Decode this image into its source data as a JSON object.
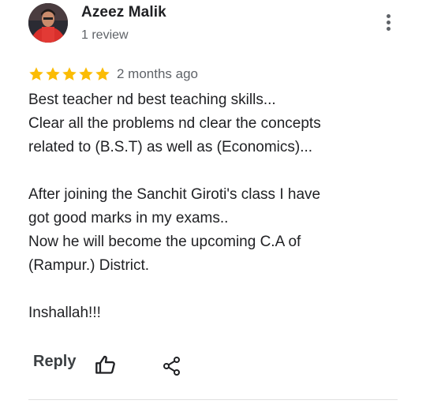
{
  "review": {
    "author": "Azeez Malik",
    "review_count": "1 review",
    "rating": 5,
    "rating_max": 5,
    "star_color": "#fbbc04",
    "date": "2 months ago",
    "lines": [
      "Best teacher nd best teaching skills...",
      "Clear all the problems nd clear the concepts",
      "related to (B.S.T) as well as (Economics)...",
      "",
      "After joining the Sanchit Giroti's class I have",
      "got good marks in my exams..",
      "Now he will become the upcoming C.A of",
      "(Rampur.) District.",
      "",
      "Inshallah!!!"
    ]
  },
  "actions": {
    "reply_label": "Reply"
  },
  "icons": {
    "more": "more-vert-icon",
    "like": "thumb-up-icon",
    "share": "share-icon"
  }
}
